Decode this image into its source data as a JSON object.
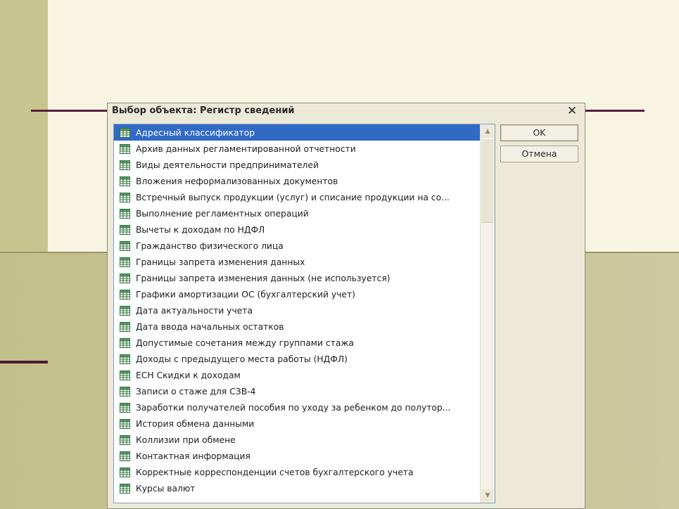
{
  "dialog": {
    "title": "Выбор объекта: Регистр сведений",
    "close_glyph": "✕",
    "ok_label": "OK",
    "cancel_label": "Отмена"
  },
  "list": {
    "icon": "register-table-icon",
    "selected_index": 0,
    "items": [
      "Адресный классификатор",
      "Архив данных регламентированной отчетности",
      "Виды деятельности предпринимателей",
      "Вложения неформализованных документов",
      "Встречный выпуск продукции (услуг) и списание продукции на со...",
      "Выполнение регламентных операций",
      "Вычеты к доходам по НДФЛ",
      "Гражданство физического лица",
      "Границы запрета изменения данных",
      "Границы запрета изменения данных (не используется)",
      "Графики амортизации ОС (бухгалтерский учет)",
      "Дата актуальности учета",
      "Дата ввода начальных остатков",
      "Допустимые сочетания между группами стажа",
      "Доходы с предыдущего места работы (НДФЛ)",
      "ЕСН Скидки к доходам",
      "Записи о стаже для СЗВ-4",
      "Заработки получателей пособия по уходу за ребенком до полутор...",
      "История обмена данными",
      "Коллизии при обмене",
      "Контактная информация",
      "Корректные корреспонденции счетов бухгалтерского учета",
      "Курсы валют"
    ]
  },
  "scrollbar": {
    "up_glyph": "▲",
    "down_glyph": "▼"
  },
  "colors": {
    "selection": "#316ac5",
    "dialog_bg": "#ece9d8",
    "slide_accent": "#5a1f3f"
  }
}
